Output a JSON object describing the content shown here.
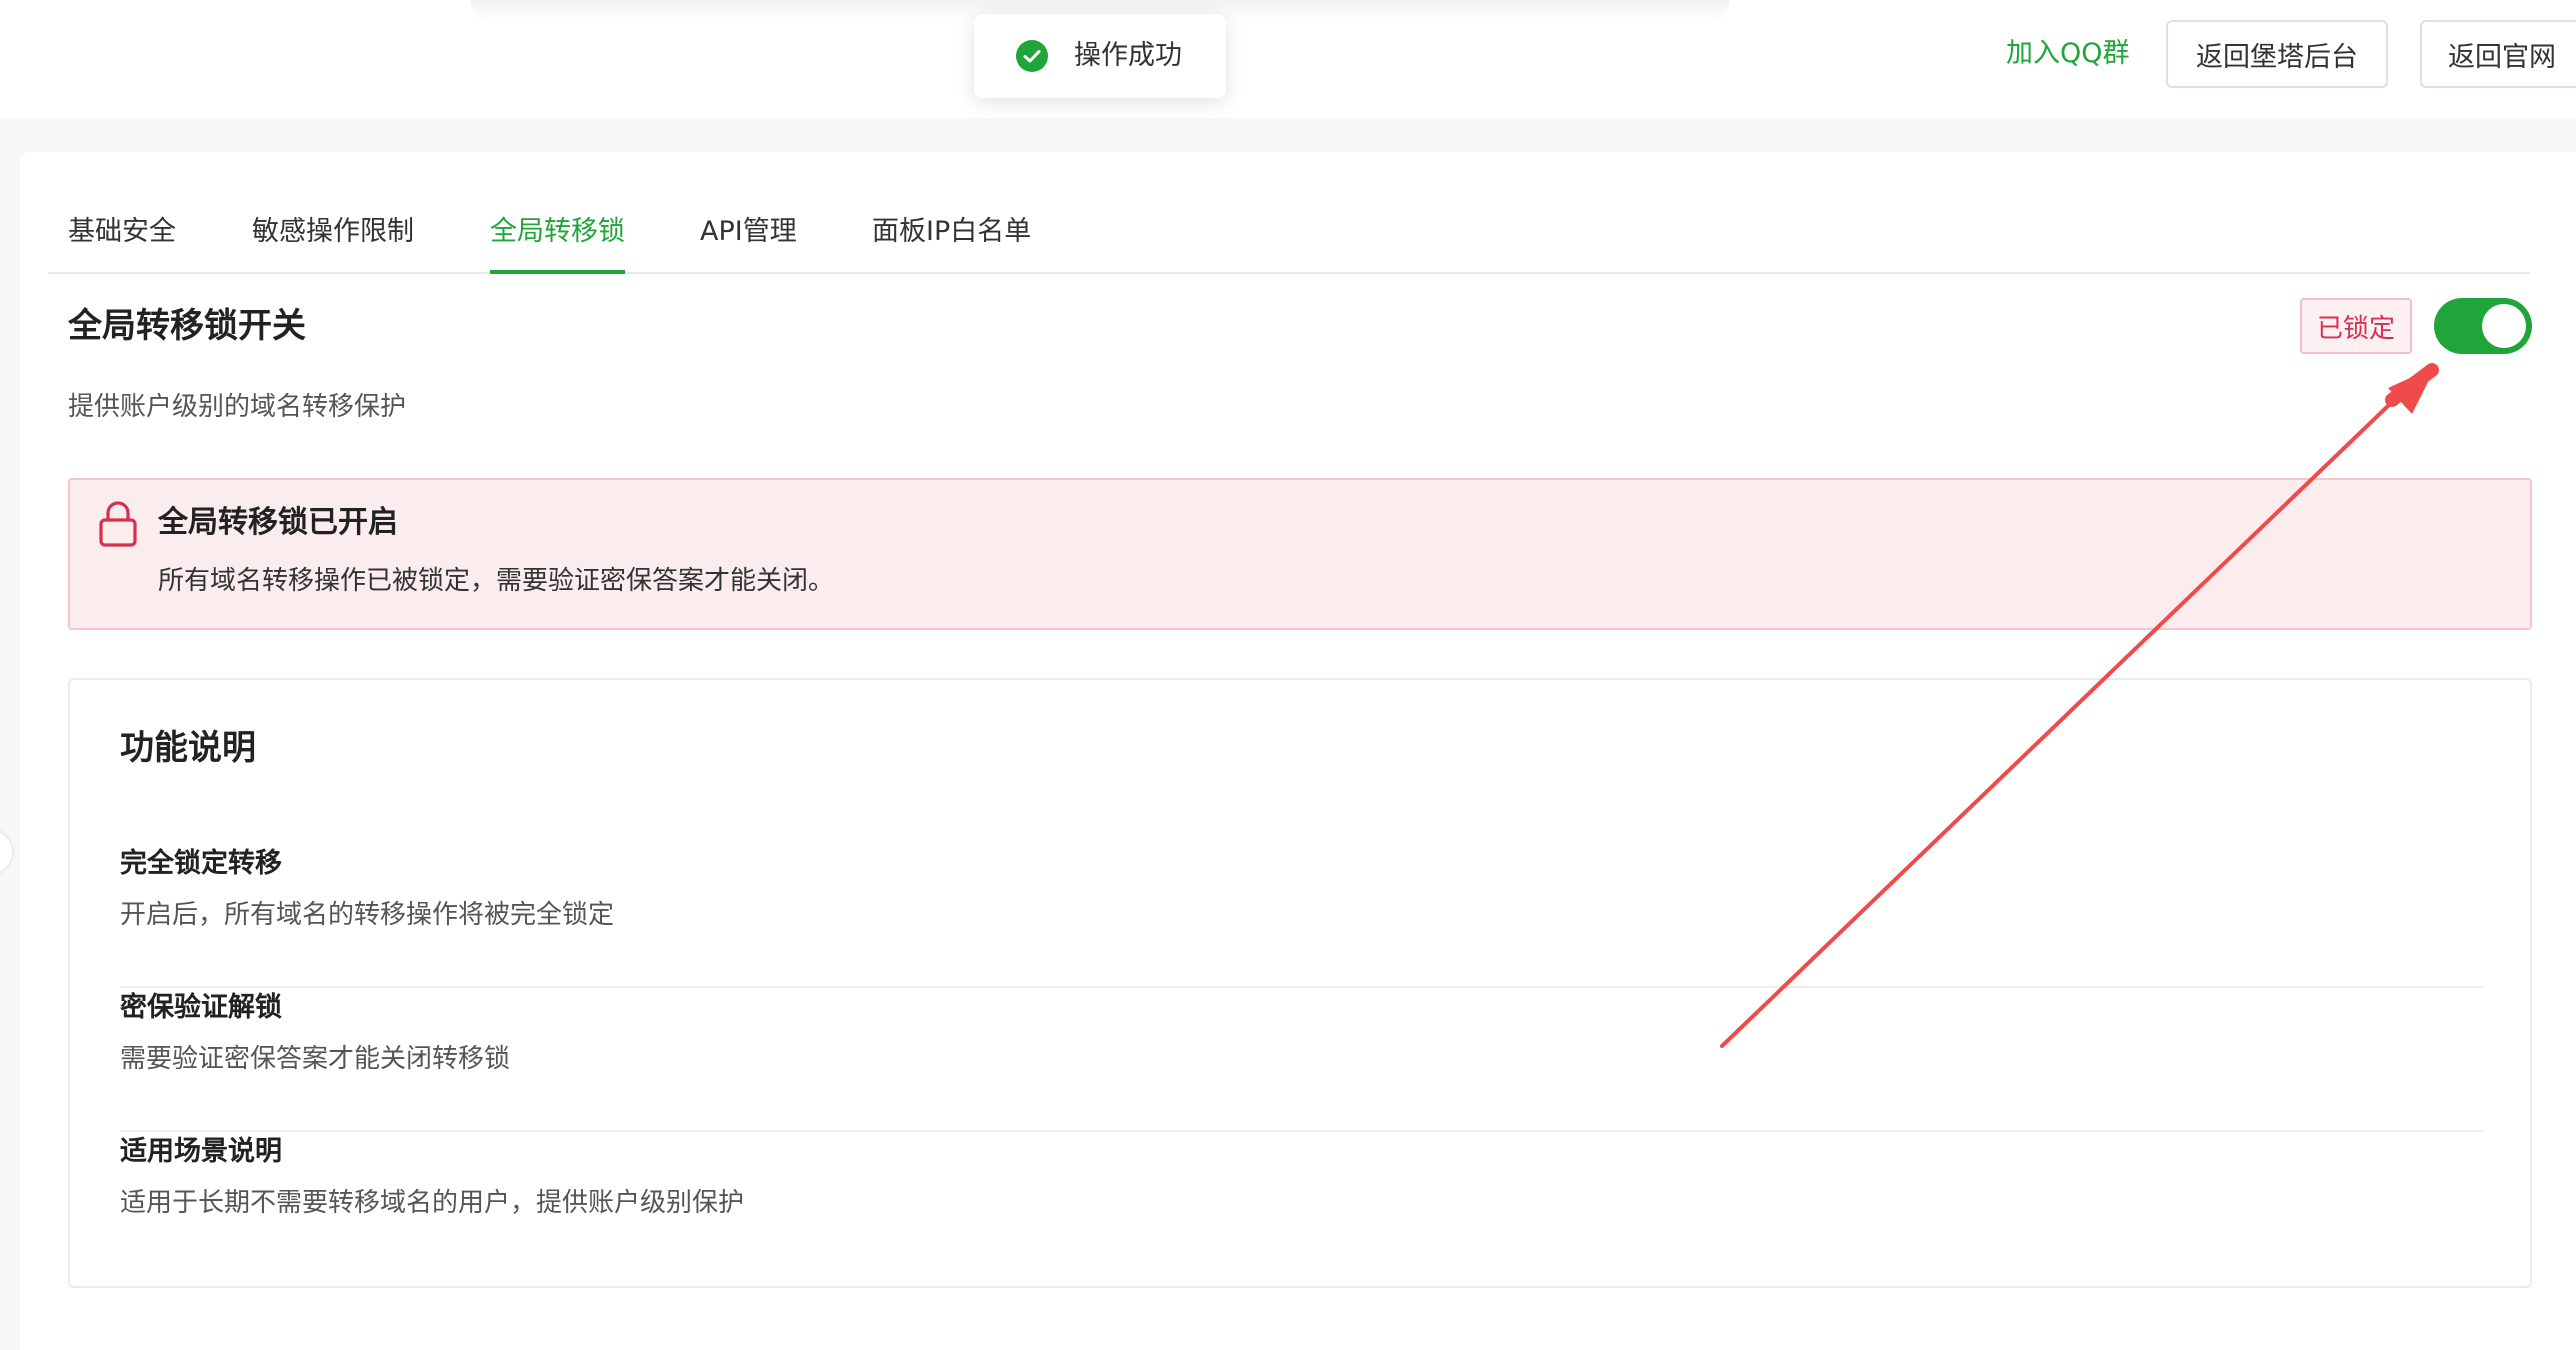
{
  "header": {
    "qq_group_link": "加入QQ群",
    "back_panel_button": "返回堡塔后台",
    "back_site_button": "返回官网"
  },
  "toast": {
    "message": "操作成功",
    "icon": "check-circle-icon"
  },
  "tabs": [
    {
      "label": "基础安全",
      "active": false
    },
    {
      "label": "敏感操作限制",
      "active": false
    },
    {
      "label": "全局转移锁",
      "active": true
    },
    {
      "label": "API管理",
      "active": false
    },
    {
      "label": "面板IP白名单",
      "active": false
    }
  ],
  "lock_section": {
    "title": "全局转移锁开关",
    "description": "提供账户级别的域名转移保护",
    "status_badge": "已锁定",
    "switch_on": true
  },
  "alert": {
    "title": "全局转移锁已开启",
    "text": "所有域名转移操作已被锁定，需要验证密保答案才能关闭。",
    "icon": "lock-icon"
  },
  "features": {
    "title": "功能说明",
    "items": [
      {
        "title": "完全锁定转移",
        "desc": "开启后，所有域名的转移操作将被完全锁定"
      },
      {
        "title": "密保验证解锁",
        "desc": "需要验证密保答案才能关闭转移锁"
      },
      {
        "title": "适用场景说明",
        "desc": "适用于长期不需要转移域名的用户，提供账户级别保护"
      }
    ]
  },
  "colors": {
    "accent_green": "#20a53a",
    "danger_red": "#d6304e",
    "alert_bg": "#fbecee",
    "annotation_arrow": "#f04b4b"
  }
}
